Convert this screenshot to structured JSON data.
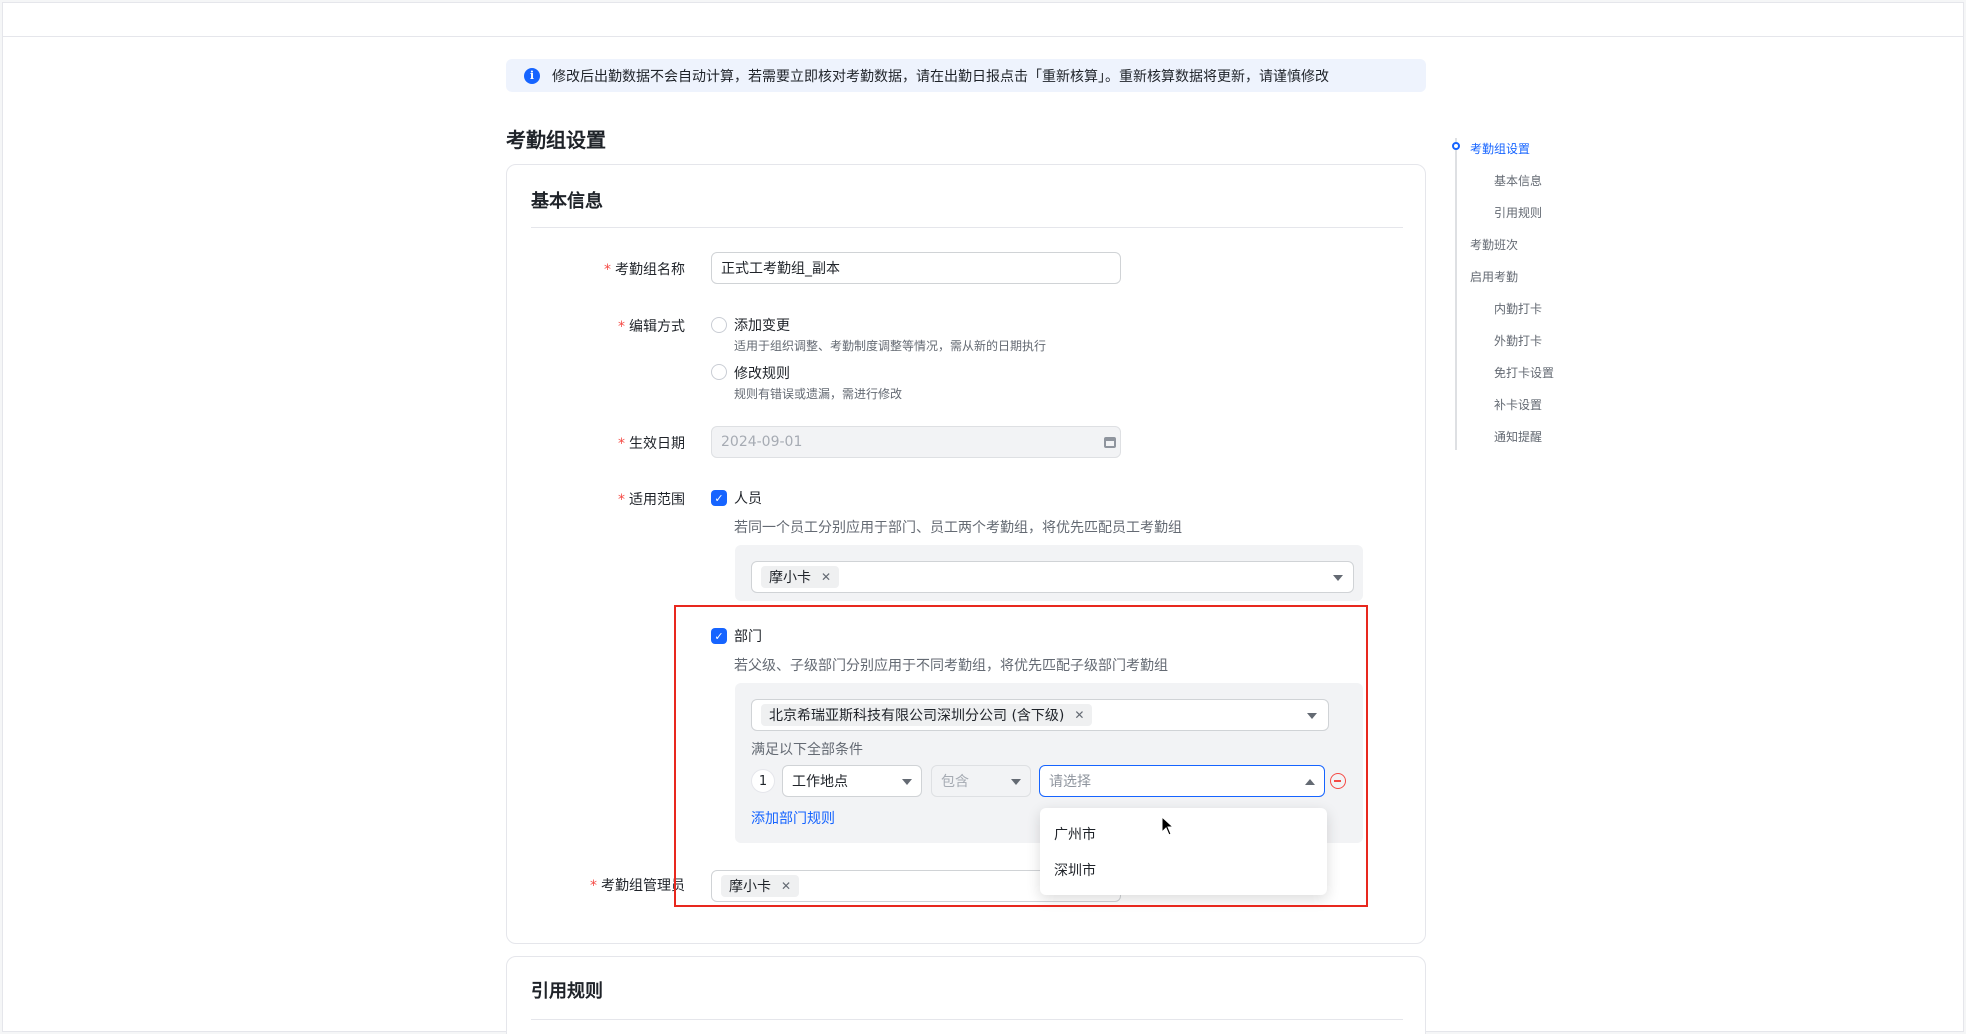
{
  "banner": {
    "icon": "info-icon",
    "text": "修改后出勤数据不会自动计算，若需要立即核对考勤数据，请在出勤日报点击「重新核算」。重新核算数据将更新，请谨慎修改"
  },
  "page_title": "考勤组设置",
  "basic_info": {
    "title": "基本信息",
    "group_name": {
      "label": "考勤组名称",
      "value": "正式工考勤组_副本"
    },
    "edit_mode": {
      "label": "编辑方式",
      "options": [
        {
          "title": "添加变更",
          "desc": "适用于组织调整、考勤制度调整等情况，需从新的日期执行"
        },
        {
          "title": "修改规则",
          "desc": "规则有错误或遗漏，需进行修改"
        }
      ]
    },
    "effective_date": {
      "label": "生效日期",
      "placeholder": "2024-09-01"
    },
    "scope": {
      "label": "适用范围",
      "person": {
        "label": "人员",
        "hint": "若同一个员工分别应用于部门、员工两个考勤组，将优先匹配员工考勤组",
        "tag": "摩小卡"
      },
      "department": {
        "label": "部门",
        "hint": "若父级、子级部门分别应用于不同考勤组，将优先匹配子级部门考勤组",
        "tag": "北京希瑞亚斯科技有限公司深圳分公司 (含下级)",
        "condition_hint": "满足以下全部条件",
        "rule": {
          "index": "1",
          "field": "工作地点",
          "operator": "包含",
          "value_placeholder": "请选择"
        },
        "add_rule": "添加部门规则",
        "dropdown_options": [
          "广州市",
          "深圳市"
        ]
      }
    },
    "admin": {
      "label": "考勤组管理员",
      "tag": "摩小卡"
    }
  },
  "rule_section": {
    "title": "引用规则"
  },
  "anchor_nav": {
    "items": [
      {
        "label": "考勤组设置",
        "level": 1,
        "active": true
      },
      {
        "label": "基本信息",
        "level": 2
      },
      {
        "label": "引用规则",
        "level": 2
      },
      {
        "label": "考勤班次",
        "level": 1
      },
      {
        "label": "启用考勤",
        "level": 1
      },
      {
        "label": "内勤打卡",
        "level": 2
      },
      {
        "label": "外勤打卡",
        "level": 2
      },
      {
        "label": "免打卡设置",
        "level": 2
      },
      {
        "label": "补卡设置",
        "level": 2
      },
      {
        "label": "通知提醒",
        "level": 2
      }
    ]
  },
  "colors": {
    "accent": "#1664ff",
    "required": "#f54a45",
    "highlight": "#e8281e"
  }
}
